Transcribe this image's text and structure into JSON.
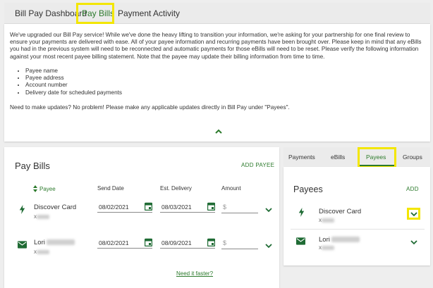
{
  "top_tabs": [
    {
      "label": "Bill Pay Dashboard"
    },
    {
      "label": "Pay Bills"
    },
    {
      "label": "Payment Activity"
    }
  ],
  "info": {
    "paragraph": "We've upgraded our Bill Pay service! While we've done the heavy lifting to transition your information, we're asking for your partnership for one final review to ensure your payments are delivered with ease. All of your payee information and recurring payments have been brought over. Please keep in mind that any eBills you had in the previous system will need to be reconnected and automatic payments for those eBills will need to be reset. Please verify the following information against your most recent payee billing statement. Note that the payee may update their billing information from time to time.",
    "bullets": [
      "Payee name",
      "Payee address",
      "Account number",
      "Delivery date for scheduled payments"
    ],
    "footer": "Need to make updates? No problem! Please make any applicable updates directly in Bill Pay under \"Payees\"."
  },
  "pay_bills": {
    "title": "Pay Bills",
    "add_payee": "ADD PAYEE",
    "columns": {
      "payee": "Payee",
      "send_date": "Send Date",
      "est_delivery": "Est. Delivery",
      "amount": "Amount"
    },
    "rows": [
      {
        "name": "Discover Card",
        "sub": "x",
        "send_date": "08/02/2021",
        "est_delivery": "08/03/2021",
        "amount_placeholder": "$",
        "icon": "lightning-icon"
      },
      {
        "name": "Lori",
        "sub": "x",
        "send_date": "08/02/2021",
        "est_delivery": "08/09/2021",
        "amount_placeholder": "$",
        "icon": "envelope-icon"
      }
    ],
    "need_faster": "Need it faster?"
  },
  "right_tabs": [
    {
      "label": "Payments"
    },
    {
      "label": "eBills"
    },
    {
      "label": "Payees"
    },
    {
      "label": "Groups"
    }
  ],
  "payees_panel": {
    "title": "Payees",
    "add": "ADD",
    "items": [
      {
        "name": "Discover Card",
        "sub": "x",
        "icon": "lightning-icon"
      },
      {
        "name": "Lori",
        "sub": "x",
        "icon": "envelope-icon"
      }
    ]
  },
  "colors": {
    "accent": "#2c7a2c",
    "highlight": "#f3e600",
    "icon": "#1f6b34"
  }
}
